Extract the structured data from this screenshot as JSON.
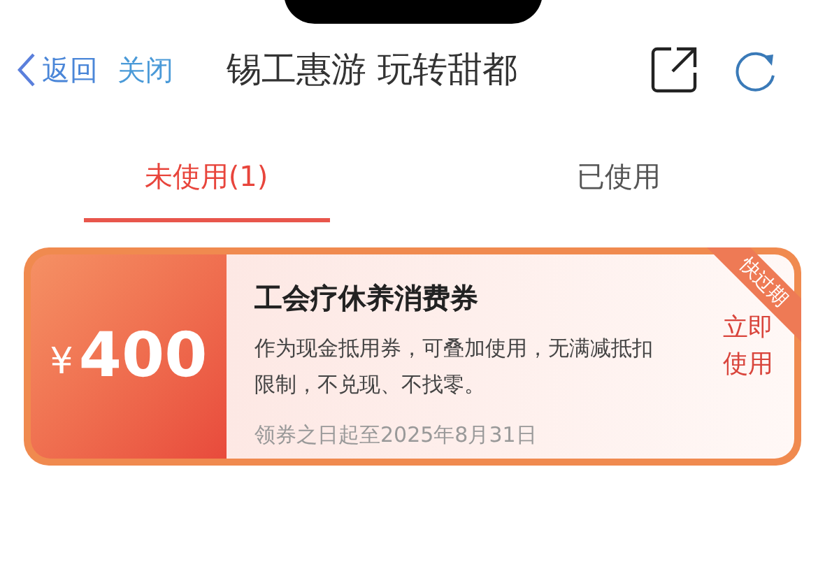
{
  "nav": {
    "back": "返回",
    "close": "关闭",
    "title": "锡工惠游 玩转甜都"
  },
  "tabs": [
    {
      "label": "未使用(1)",
      "selected": true
    },
    {
      "label": "已使用",
      "selected": false
    }
  ],
  "coupons": [
    {
      "currency": "¥",
      "amount": "400",
      "name": "工会疗休养消费券",
      "description": "作为现金抵用券，可叠加使用，无满减抵扣限制，不兑现、不找零。",
      "validity": "领券之日起至2025年8月31日",
      "action": "立即使用",
      "ribbon": "快过期"
    }
  ]
}
